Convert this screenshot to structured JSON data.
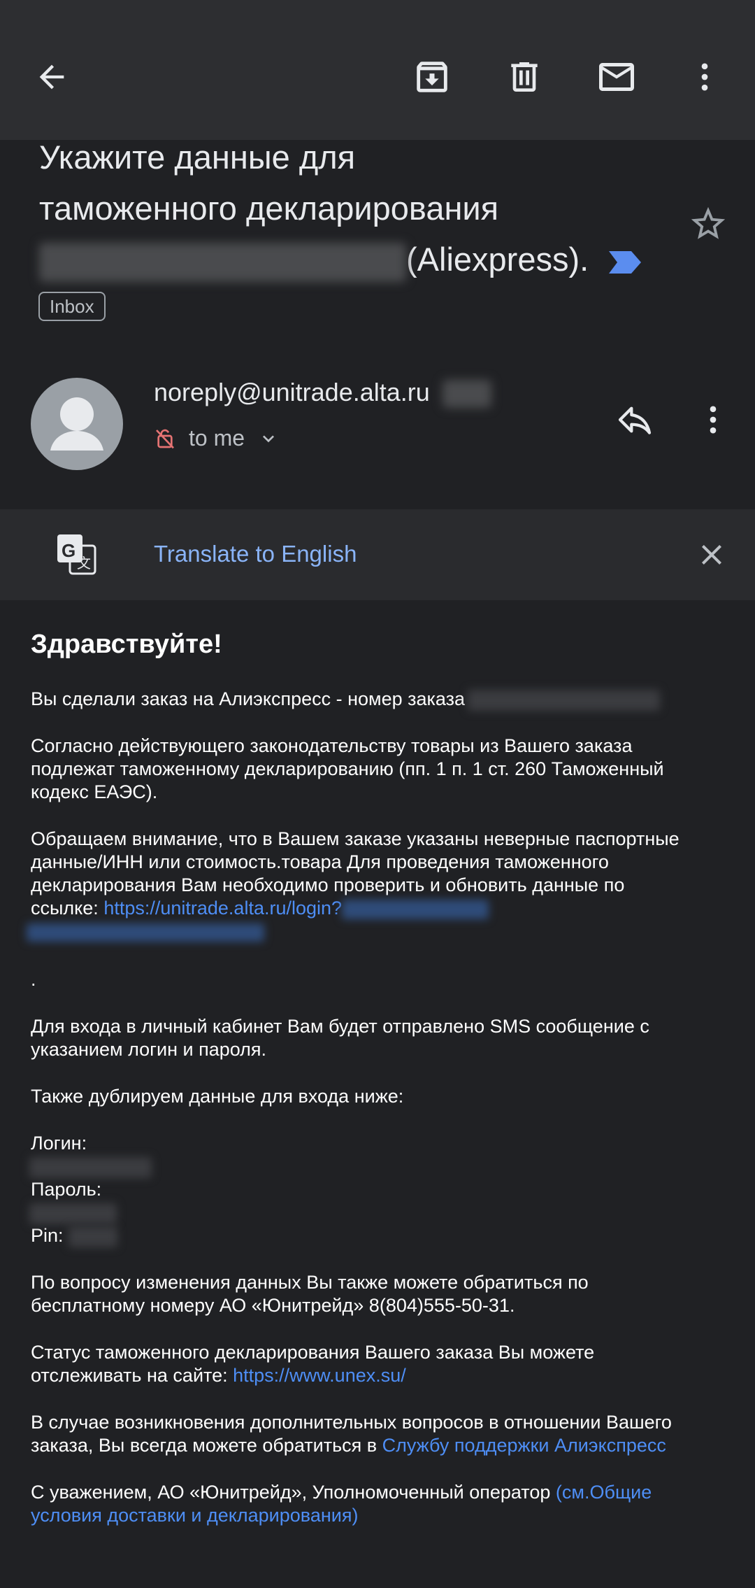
{
  "toolbar": {
    "back_icon": "arrow-back-icon",
    "archive_icon": "archive-icon",
    "delete_icon": "trash-icon",
    "unread_icon": "mail-icon",
    "more_icon": "more-vert-icon"
  },
  "subject": {
    "line1": "Укажите данные для",
    "line2": "таможенного декларирования",
    "line3_suffix": "(Aliexpress).",
    "label": "Inbox"
  },
  "sender": {
    "email": "noreply@unitrade.alta.ru",
    "to": "to me"
  },
  "translate": {
    "label": "Translate to English"
  },
  "body": {
    "greeting": "Здравствуйте!",
    "p1": "Вы сделали заказ на Алиэкспресс - номер заказа",
    "p2_l1": "Согласно действующего законодательству товары из Вашего заказа",
    "p2_l2": "подлежат таможенному декларированию (пп. 1 п. 1 ст. 260 Таможенный",
    "p2_l3": "кодекс ЕАЭС).",
    "p3_l1": "Обращаем внимание, что в Вашем заказе указаны неверные паспортные",
    "p3_l2": "данные/ИНН или стоимость.товара Для проведения таможенного",
    "p3_l3": "декларирования Вам необходимо проверить и обновить данные по",
    "p3_l4_prefix": "ссылке:",
    "p3_link": "https://unitrade.alta.ru/login?",
    "dot": ".",
    "p4_l1": "Для входа в личный кабинет Вам будет отправлено SMS сообщение с",
    "p4_l2": "указанием логин и пароля.",
    "p5": "Также дублируем данные для входа ниже:",
    "login_label": "Логин:",
    "password_label": "Пароль:",
    "pin_label": "Pin:",
    "p6_l1": "По вопросу изменения данных Вы также можете обратиться по",
    "p6_l2": "бесплатному номеру АО «Юнитрейд» 8(804)555-50-31.",
    "p7_l1": "Статус таможенного декларирования Вашего заказа Вы можете",
    "p7_l2_prefix": "отслеживать на сайте:",
    "p7_link": "https://www.unex.su/",
    "p8_l1": "В случае возникновения дополнительных вопросов в отношении Вашего",
    "p8_l2_prefix": "заказа, Вы всегда можете обратиться в",
    "p8_link": "Службу поддержки Алиэкспресс",
    "p9_prefix": "С уважением, АО «Юнитрейд», Уполномоченный оператор",
    "p9_link_l1": "(см.Общие",
    "p9_link_l2": "условия доставки и декларирования)"
  },
  "colors": {
    "background": "#202124",
    "appbar": "#2d2e31",
    "link": "#4e8ef5",
    "translate_link": "#8ab4f8",
    "important_marker": "#5b8def"
  }
}
